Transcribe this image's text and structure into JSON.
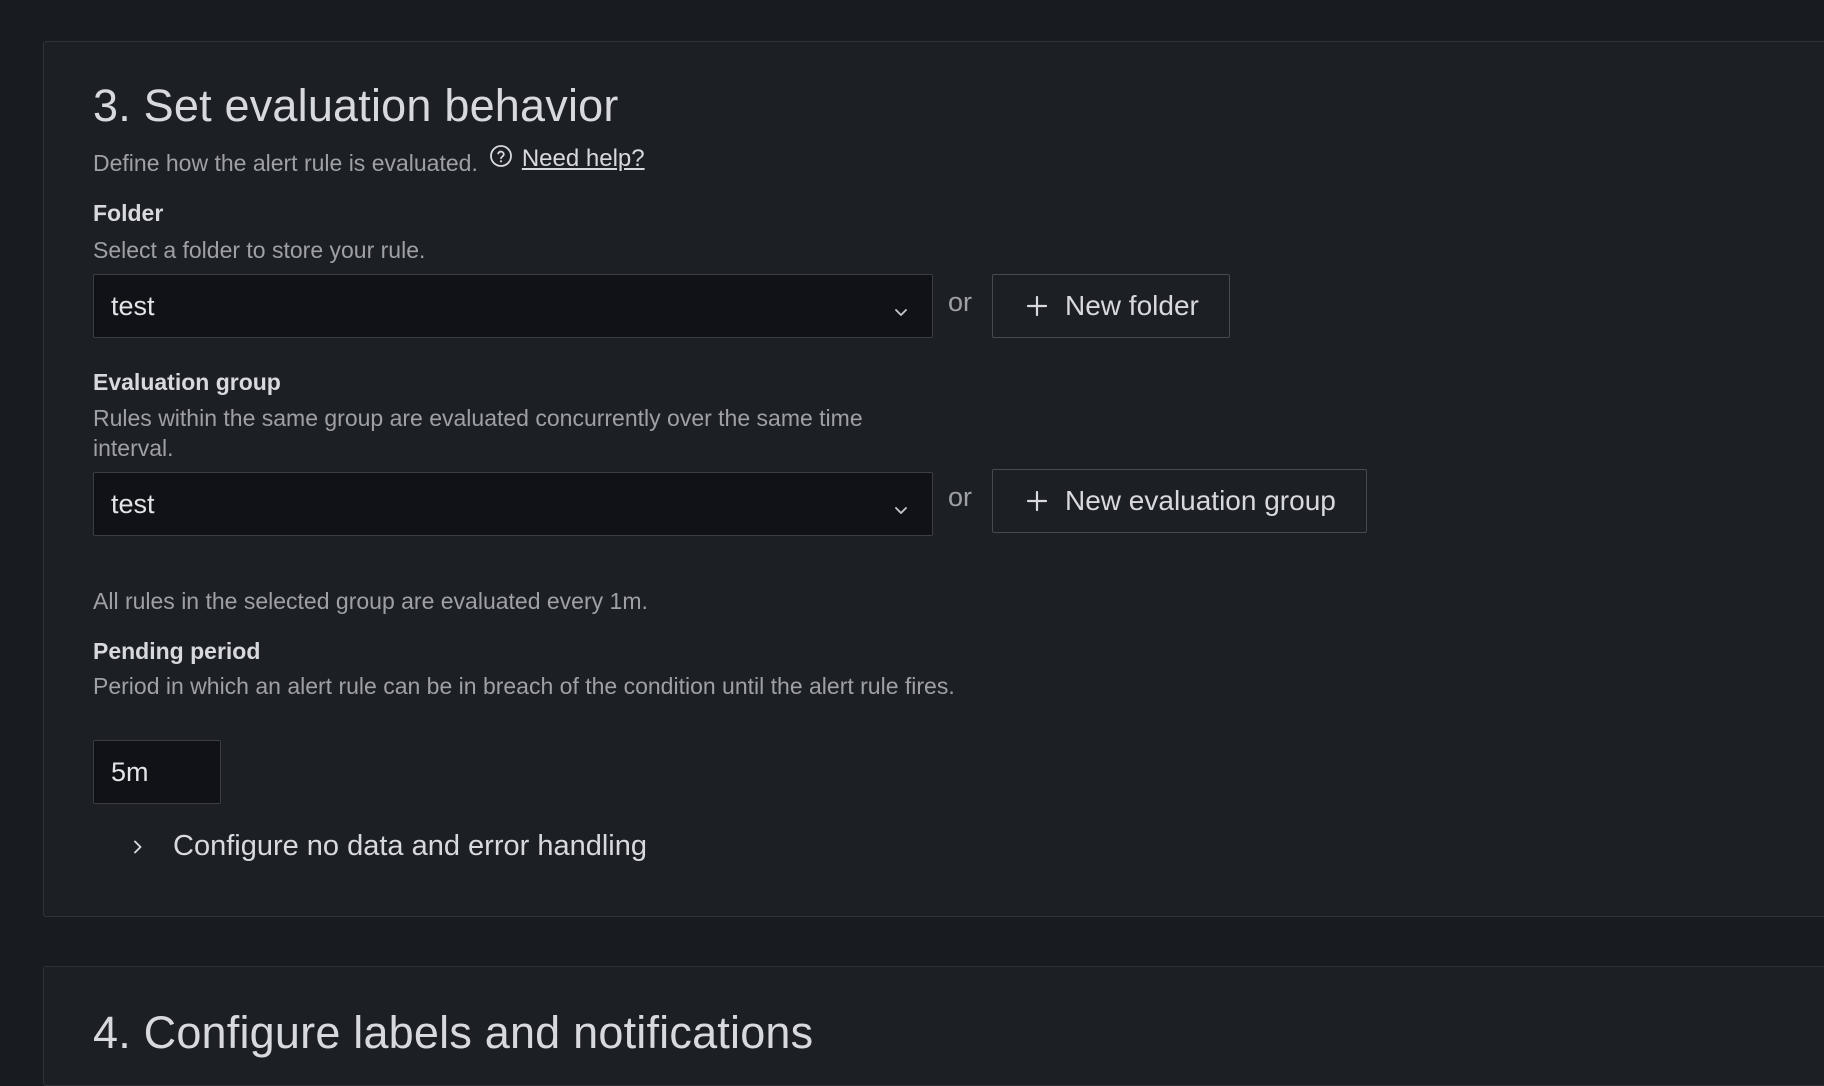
{
  "section3": {
    "title": "3. Set evaluation behavior",
    "description": "Define how the alert rule is evaluated.",
    "help_link": "Need help?",
    "folder": {
      "label": "Folder",
      "description": "Select a folder to store your rule.",
      "selected": "test",
      "or_text": "or",
      "new_button": "New folder"
    },
    "evaluation_group": {
      "label": "Evaluation group",
      "description": "Rules within the same group are evaluated concurrently over the same time interval.",
      "selected": "test",
      "or_text": "or",
      "new_button": "New evaluation group"
    },
    "evaluation_info": "All rules in the selected group are evaluated every 1m.",
    "pending_period": {
      "label": "Pending period",
      "description": "Period in which an alert rule can be in breach of the condition until the alert rule fires.",
      "value": "5m"
    },
    "collapse_label": "Configure no data and error handling"
  },
  "section4": {
    "title": "4. Configure labels and notifications"
  },
  "icons": {
    "help": "question-circle-icon",
    "chevron_down": "chevron-down-icon",
    "plus": "plus-icon",
    "chevron_right": "chevron-right-icon"
  },
  "colors": {
    "background": "#181b1f",
    "panel": "#1c1f24",
    "input": "#111217",
    "text_primary": "#d8d9de",
    "text_secondary": "#9fa0a7"
  }
}
